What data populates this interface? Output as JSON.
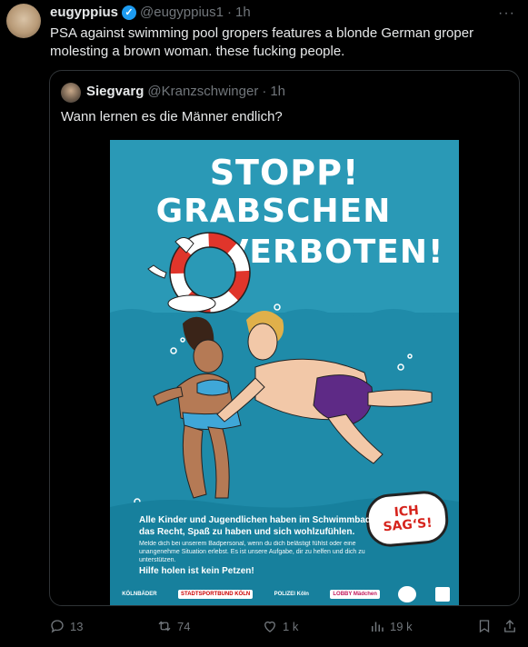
{
  "tweet": {
    "author_name": "eugyppius",
    "handle": "@eugyppius1",
    "time": "1h",
    "text": "PSA against swimming pool gropers features a blonde German groper molesting a brown woman. these fucking people."
  },
  "quote": {
    "author_name": "Siegvarg",
    "handle": "@Kranzschwinger",
    "time": "1h",
    "text": "Wann lernen es die Männer endlich?"
  },
  "poster": {
    "title_line1": "STOPP!",
    "title_line2": "GRABSCHEN",
    "title_line3": "VERBOTEN!",
    "main_text": "Alle Kinder und Jugendlichen haben im Schwimmbad das Recht, Spaß zu haben und sich wohlzufühlen.",
    "small_text": "Melde dich bei unserem Badpersonal, wenn du dich belästigt fühlst oder eine unangenehme Situation erlebst. Es ist unsere Aufgabe, dir zu helfen und dich zu unterstützen.",
    "help_text": "Hilfe holen ist kein Petzen!",
    "speech_line1": "ICH",
    "speech_line2": "SAG‘S!",
    "logos": [
      "KÖLNBÄDER",
      "STADTSPORTBUND KÖLN",
      "POLIZEI Köln",
      "LOBBY Mädchen"
    ]
  },
  "actions": {
    "replies": "13",
    "reposts": "74",
    "likes": "1 k",
    "views": "19 k"
  },
  "colors": {
    "background": "#000000",
    "verified": "#1d9bf0",
    "poster_blue": "#2a99b6",
    "swimsuit_purple": "#5e2a86",
    "ring_red": "#e0352b"
  }
}
